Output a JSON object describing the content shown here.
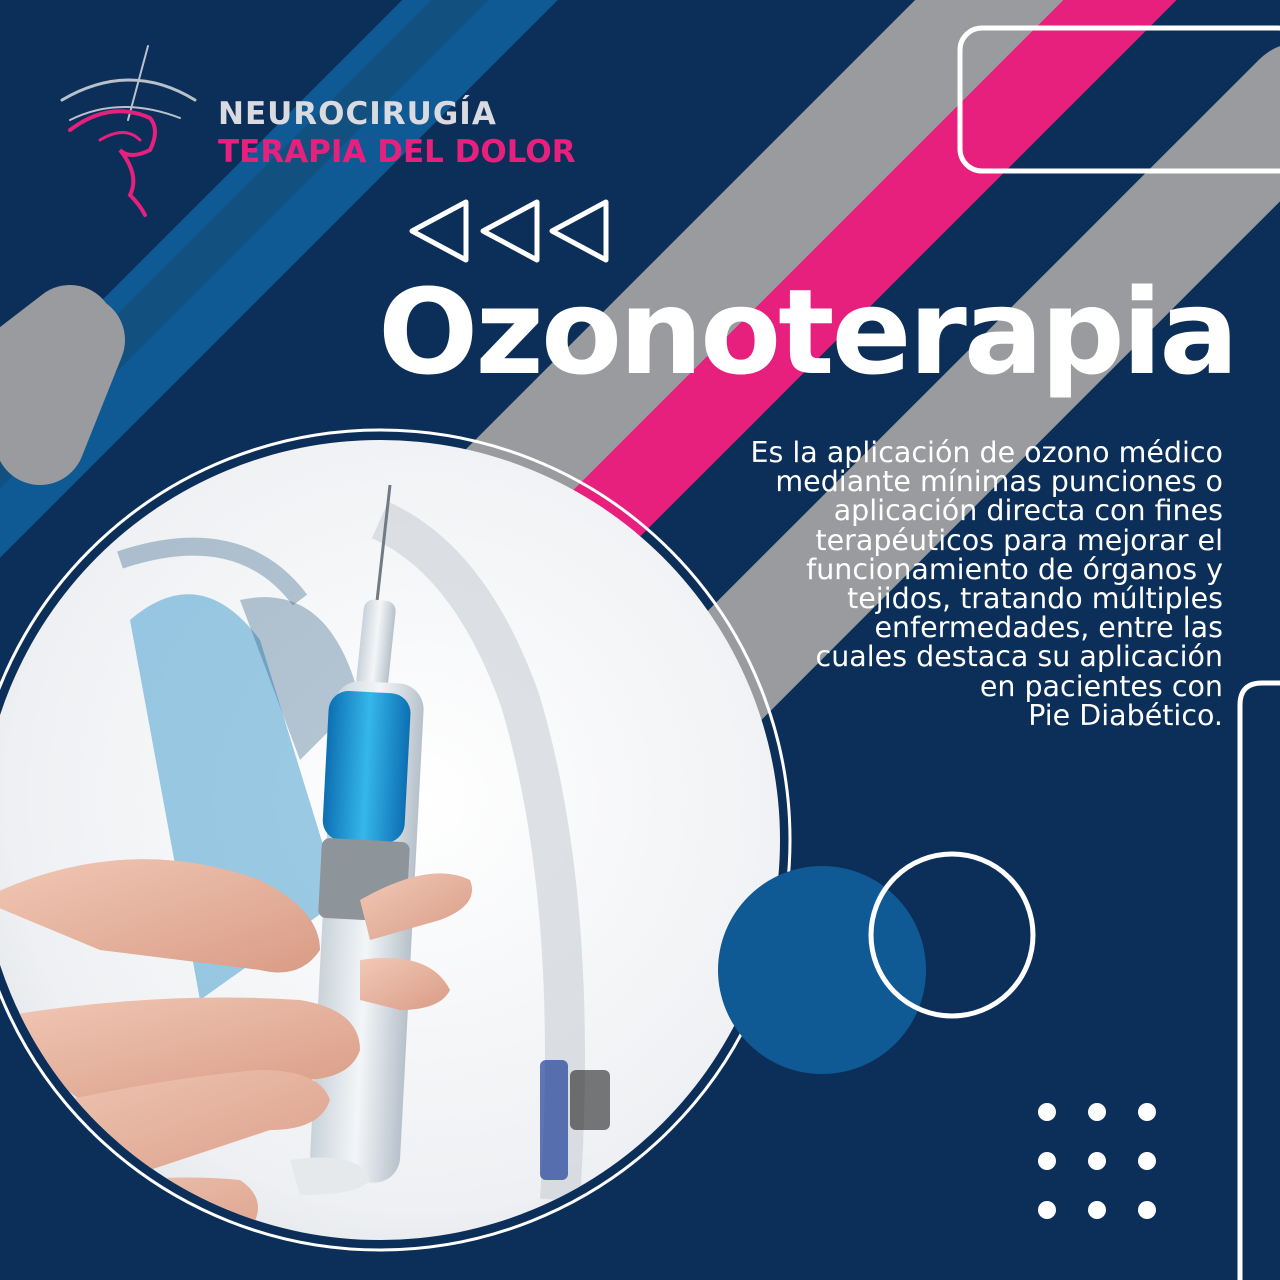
{
  "brand": {
    "line1": "NEUROCIRUGÍA",
    "line2": "TERAPIA DEL DOLOR",
    "logo_icon": "head-profile-logo-icon"
  },
  "title": "Ozonoterapia",
  "description_lines": [
    "Es la aplicación de ozono médico",
    "mediante mínimas punciones o",
    "aplicación directa con fines",
    "terapéuticos para mejorar el",
    "funcionamiento de órganos y",
    "tejidos, tratando múltiples",
    "enfermedades, entre las",
    "cuales destaca su aplicación",
    "en pacientes con",
    "Pie Diabético."
  ],
  "photo": {
    "subject": "syringe-with-blue-liquid-held-by-hand-icon"
  },
  "colors": {
    "background": "#0c2f5a",
    "accent_pink": "#e6207c",
    "accent_blue": "#0f5a94",
    "stripe_gray": "#9a9b9e",
    "text_white": "#ffffff",
    "brand_gray": "#d9dbe0"
  }
}
